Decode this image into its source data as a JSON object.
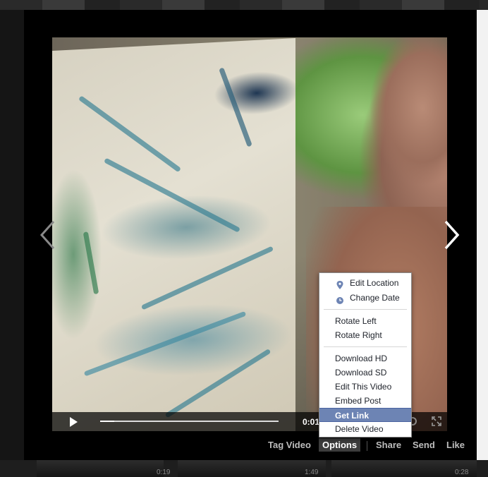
{
  "background": {
    "thumbnails": [
      {
        "duration": "0:19"
      },
      {
        "duration": "1:49"
      },
      {
        "duration": "0:28"
      }
    ]
  },
  "player": {
    "timecode": "0:01",
    "progress_fraction": 0.08,
    "play_icon": "play-icon",
    "fullscreen_icon": "fullscreen-icon"
  },
  "navigation": {
    "prev_icon": "chevron-left-icon",
    "next_icon": "chevron-right-icon"
  },
  "actions": {
    "tag_video": "Tag Video",
    "options": "Options",
    "share": "Share",
    "send": "Send",
    "like": "Like"
  },
  "options_menu": {
    "edit_location": "Edit Location",
    "change_date": "Change Date",
    "rotate_left": "Rotate Left",
    "rotate_right": "Rotate Right",
    "download_hd": "Download HD",
    "download_sd": "Download SD",
    "edit_this_video": "Edit This Video",
    "embed_post": "Embed Post",
    "get_link": "Get Link",
    "delete_video": "Delete Video",
    "highlight_color": "#6d84b4",
    "icon_color": "#6d84b4"
  }
}
